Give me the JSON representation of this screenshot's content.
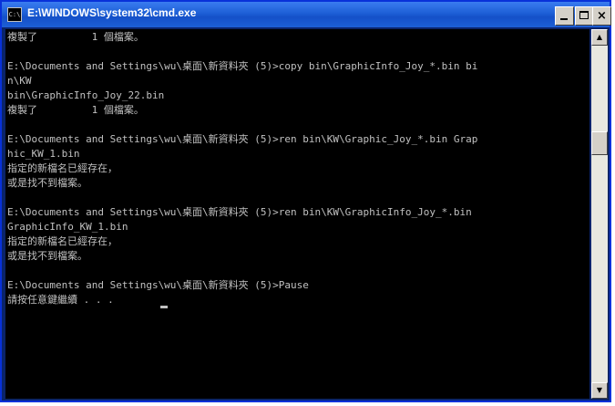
{
  "window": {
    "title": "E:\\WINDOWS\\system32\\cmd.exe",
    "icon_label": "C:\\",
    "controls": {
      "minimize": "minimize",
      "maximize": "maximize",
      "close": "×"
    }
  },
  "console": {
    "lines": [
      "複製了         1 個檔案。",
      "",
      "E:\\Documents and Settings\\wu\\桌面\\新資料夾 (5)>copy bin\\GraphicInfo_Joy_*.bin bi",
      "n\\KW",
      "bin\\GraphicInfo_Joy_22.bin",
      "複製了         1 個檔案。",
      "",
      "E:\\Documents and Settings\\wu\\桌面\\新資料夾 (5)>ren bin\\KW\\Graphic_Joy_*.bin Grap",
      "hic_KW_1.bin",
      "指定的新檔名已經存在，",
      "或是找不到檔案。",
      "",
      "E:\\Documents and Settings\\wu\\桌面\\新資料夾 (5)>ren bin\\KW\\GraphicInfo_Joy_*.bin",
      "GraphicInfo_KW_1.bin",
      "指定的新檔名已經存在，",
      "或是找不到檔案。",
      "",
      "E:\\Documents and Settings\\wu\\桌面\\新資料夾 (5)>Pause",
      "請按任意鍵繼續 . . ."
    ]
  },
  "scrollbar": {
    "up_arrow": "▲",
    "down_arrow": "▼"
  },
  "colors": {
    "titlebar": "#1d5fd6",
    "console_bg": "#000000",
    "console_fg": "#c0c0c0"
  }
}
